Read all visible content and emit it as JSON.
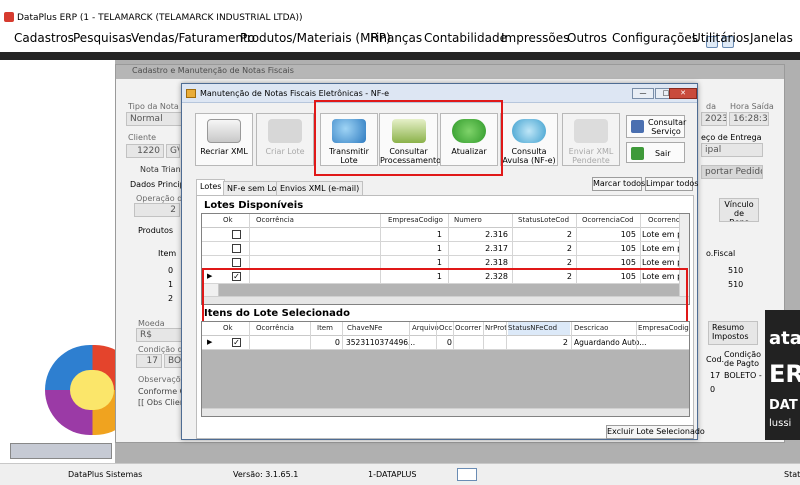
{
  "app": {
    "title": "DataPlus ERP (1 - TELAMARCK (TELAMARCK INDUSTRIAL LTDA))"
  },
  "menu": [
    "Cadastros",
    "Pesquisas",
    "Vendas/Faturamento",
    "Produtos/Materiais (MRP)",
    "Finanças",
    "Contabilidade",
    "Impressões",
    "Outros",
    "Configurações",
    "Utilitários",
    "Janelas"
  ],
  "background_window": {
    "title": "Cadastro e Manutenção de Notas Fiscais",
    "labels": {
      "tipo_nota": "Tipo da Nota",
      "cliente": "Cliente",
      "nota_triangular": "Nota Triangul",
      "dados_principais": "Dados Principais",
      "operacao": "Operação de",
      "produtos": "Produtos",
      "item": "Item",
      "moeda": "Moeda",
      "condicao": "Condição de",
      "observacoes": "Observações",
      "data": "da",
      "hora_saida": "Hora Saída",
      "preco_entrega": "eço de Entrega",
      "vinculo": "Vínculo de Bens",
      "fiscal": "o.Fiscal",
      "resumo": "Resumo Impostos",
      "cod": "Cod.",
      "cond_pagto": "Condição de Pagto",
      "importar": "portar Pedidos"
    },
    "values": {
      "tipo_nota": "Normal",
      "cliente_cod": "1220",
      "cliente_nome": "GV",
      "operacao": "2",
      "row0_item": "0",
      "row1_item": "1",
      "row2_item": "2",
      "moeda": "R$",
      "condicao_cod": "17",
      "condicao_nome": "BOLE",
      "obs1": "Conforme C",
      "obs2": "[[ Obs Clien",
      "data": "2023",
      "hora": "16:28:35",
      "cidade": "ipal",
      "cfop1": "510",
      "cfop2": "510",
      "cod_pag": "17",
      "boleto": "BOLETO -",
      "zero": "0"
    }
  },
  "right_brand": {
    "line1": "ata",
    "line2": "ERP",
    "line3": "DAT",
    "line4": "lussi"
  },
  "dialog": {
    "title": "Manutenção de Notas Fiscais Eletrônicas - NF-e",
    "toolbar": {
      "recriar": "Recriar XML",
      "criar_lote": "Criar Lote",
      "transmitir": "Transmitir Lote",
      "consultar_proc": "Consultar Processamento",
      "atualizar": "Atualizar",
      "consulta_avulsa": "Consulta Avulsa (NF-e)",
      "enviar_xml": "Enviar XML Pendente",
      "consultar_servico": "Consultar Serviço",
      "sair": "Sair"
    },
    "tabs": [
      "Lotes",
      "NF-e sem Lote",
      "Envios XML (e-mail)"
    ],
    "marcar_todos": "Marcar todos",
    "limpar_todos": "Limpar todos",
    "lotes_title": "Lotes Disponíveis",
    "lotes_columns": [
      "Ok",
      "Ocorrência",
      "EmpresaCodigo",
      "Numero",
      "StatusLoteCod",
      "OcorrenciaCod",
      "Ocorrenc"
    ],
    "lotes_rows": [
      {
        "empresa": "1",
        "numero": "2.316",
        "status": "2",
        "ocod": "105",
        "ocorr": "Lote em p"
      },
      {
        "empresa": "1",
        "numero": "2.317",
        "status": "2",
        "ocod": "105",
        "ocorr": "Lote em p"
      },
      {
        "empresa": "1",
        "numero": "2.318",
        "status": "2",
        "ocod": "105",
        "ocorr": "Lote em p"
      },
      {
        "empresa": "1",
        "numero": "2.328",
        "status": "2",
        "ocod": "105",
        "ocorr": "Lote em p"
      }
    ],
    "itens_title": "Itens do Lote Selecionado",
    "itens_columns": [
      "Ok",
      "Ocorrência",
      "Item",
      "ChaveNFe",
      "Arquivo",
      "Occ",
      "Ocorrer",
      "NrProt",
      "StatusNFeCod",
      "Descricao",
      "EmpresaCodigo"
    ],
    "itens_row": {
      "item": "0",
      "chave": "3523110374496...",
      "occ": "0",
      "status": "2",
      "descricao": "Aguardando Auto..."
    },
    "excluir": "Excluir Lote Selecionado"
  },
  "statusbar": {
    "company": "DataPlus Sistemas",
    "version": "Versão: 3.1.65.1",
    "base": "1-DATAPLUS",
    "right": "Stat"
  },
  "colors": {
    "highlight": "#e01818",
    "selection": "#dce9f8"
  }
}
